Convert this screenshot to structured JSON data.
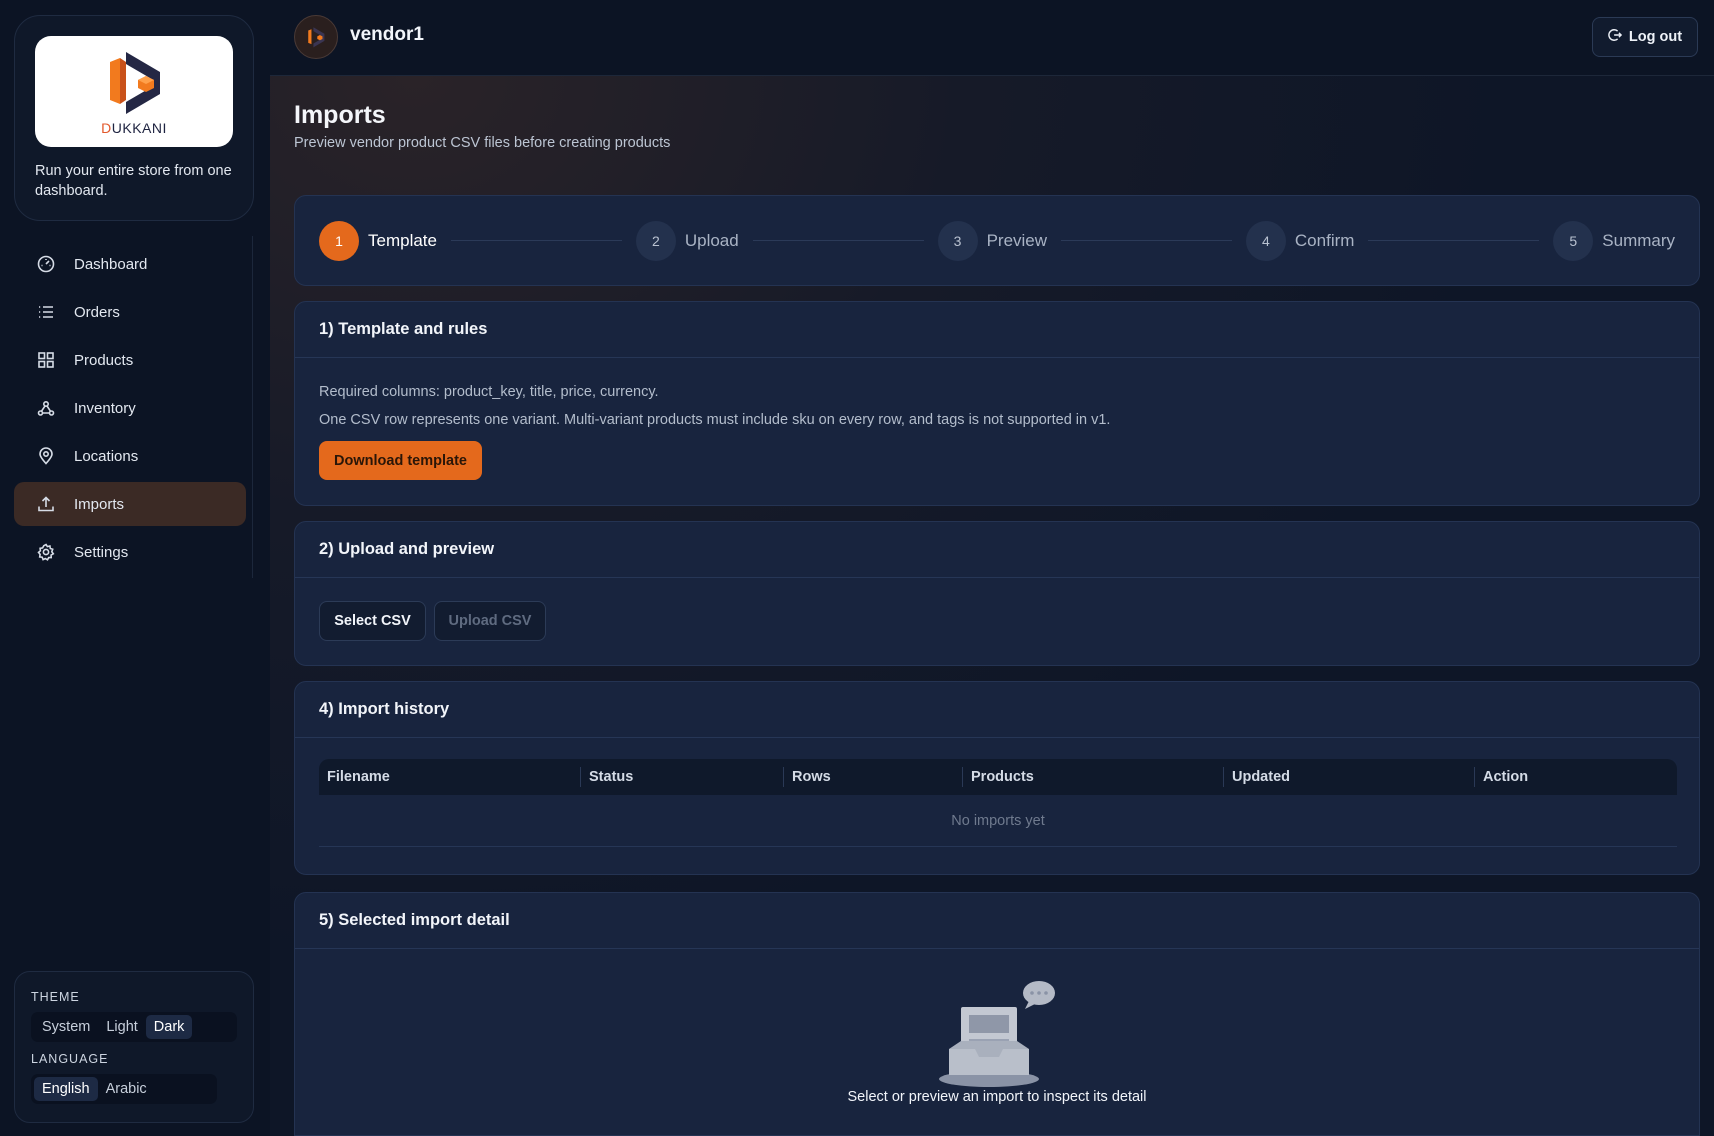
{
  "brand": {
    "logo_text_accent": "D",
    "logo_text_rest": "UKKANI",
    "tagline": "Run your entire store from one dashboard."
  },
  "sidebar": {
    "items": [
      {
        "label": "Dashboard",
        "icon": "gauge-icon",
        "active": false
      },
      {
        "label": "Orders",
        "icon": "list-icon",
        "active": false
      },
      {
        "label": "Products",
        "icon": "grid-icon",
        "active": false
      },
      {
        "label": "Inventory",
        "icon": "network-icon",
        "active": false
      },
      {
        "label": "Locations",
        "icon": "map-pin-icon",
        "active": false
      },
      {
        "label": "Imports",
        "icon": "upload-icon",
        "active": true
      },
      {
        "label": "Settings",
        "icon": "gear-icon",
        "active": false
      }
    ]
  },
  "preferences": {
    "theme_label": "THEME",
    "theme_options": [
      "System",
      "Light",
      "Dark"
    ],
    "theme_selected": "Dark",
    "language_label": "LANGUAGE",
    "language_options": [
      "English",
      "Arabic"
    ],
    "language_selected": "English"
  },
  "header": {
    "vendor_name": "vendor1",
    "logout_label": "Log out"
  },
  "page": {
    "title": "Imports",
    "subtitle": "Preview vendor product CSV files before creating products"
  },
  "stepper": {
    "steps": [
      {
        "num": "1",
        "label": "Template",
        "active": true
      },
      {
        "num": "2",
        "label": "Upload",
        "active": false
      },
      {
        "num": "3",
        "label": "Preview",
        "active": false
      },
      {
        "num": "4",
        "label": "Confirm",
        "active": false
      },
      {
        "num": "5",
        "label": "Summary",
        "active": false
      }
    ]
  },
  "template_card": {
    "title": "1) Template and rules",
    "rule_1": "Required columns: product_key, title, price, currency.",
    "rule_2": "One CSV row represents one variant. Multi-variant products must include sku on every row, and tags is not supported in v1.",
    "download_label": "Download template"
  },
  "upload_card": {
    "title": "2) Upload and preview",
    "select_label": "Select CSV",
    "upload_label": "Upload CSV"
  },
  "history_card": {
    "title": "4) Import history",
    "columns": [
      "Filename",
      "Status",
      "Rows",
      "Products",
      "Updated",
      "Action"
    ],
    "empty_text": "No imports yet"
  },
  "detail_card": {
    "title": "5) Selected import detail",
    "empty_text": "Select or preview an import to inspect its detail"
  },
  "colors": {
    "accent": "#e4691c",
    "background": "#0e1627",
    "card": "#18243e"
  }
}
